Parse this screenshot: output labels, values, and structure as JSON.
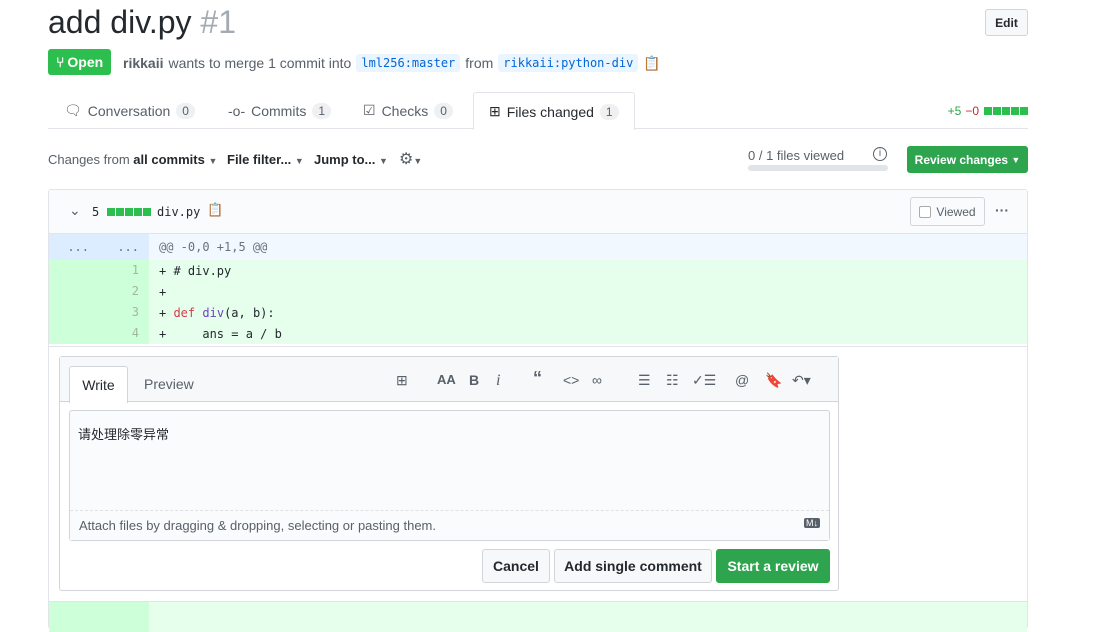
{
  "pr": {
    "title": "add div.py",
    "number": "#1",
    "edit": "Edit",
    "status": "Open",
    "author": "rikkaii",
    "merge_text": "wants to merge 1 commit into",
    "base": "lml256:master",
    "from": "from",
    "head": "rikkaii:python-div"
  },
  "tabs": [
    {
      "label": "Conversation",
      "count": "0"
    },
    {
      "label": "Commits",
      "count": "1"
    },
    {
      "label": "Checks",
      "count": "0"
    },
    {
      "label": "Files changed",
      "count": "1"
    }
  ],
  "diffstat": {
    "add": "+5",
    "del": "−0"
  },
  "toolbar": {
    "changes_from": "Changes from",
    "all_commits": "all commits",
    "file_filter": "File filter...",
    "jump_to": "Jump to...",
    "files_viewed": "0 / 1 files viewed",
    "files_viewed_fraction": 0,
    "review_changes": "Review changes"
  },
  "file": {
    "changes": "5",
    "name": "div.py",
    "viewed": "Viewed",
    "hunk": "@@ -0,0 +1,5 @@",
    "dots": "...",
    "lines": [
      {
        "n": "1",
        "code": "+ # div.py"
      },
      {
        "n": "2",
        "code": "+"
      },
      {
        "n": "3",
        "code": "+ def div(a, b):"
      },
      {
        "n": "4",
        "code": "+     ans = a / b"
      }
    ]
  },
  "comment": {
    "write": "Write",
    "preview": "Preview",
    "text": "请处理除零异常",
    "attach": "Attach files by dragging & dropping, selecting or pasting them.",
    "cancel": "Cancel",
    "add_single": "Add single comment",
    "start_review": "Start a review"
  },
  "colors": {
    "green": "#2cbe4e",
    "added_bg": "#e6ffed",
    "added_ln_bg": "#cdffd8",
    "hunk_bg": "#f1f8ff"
  }
}
